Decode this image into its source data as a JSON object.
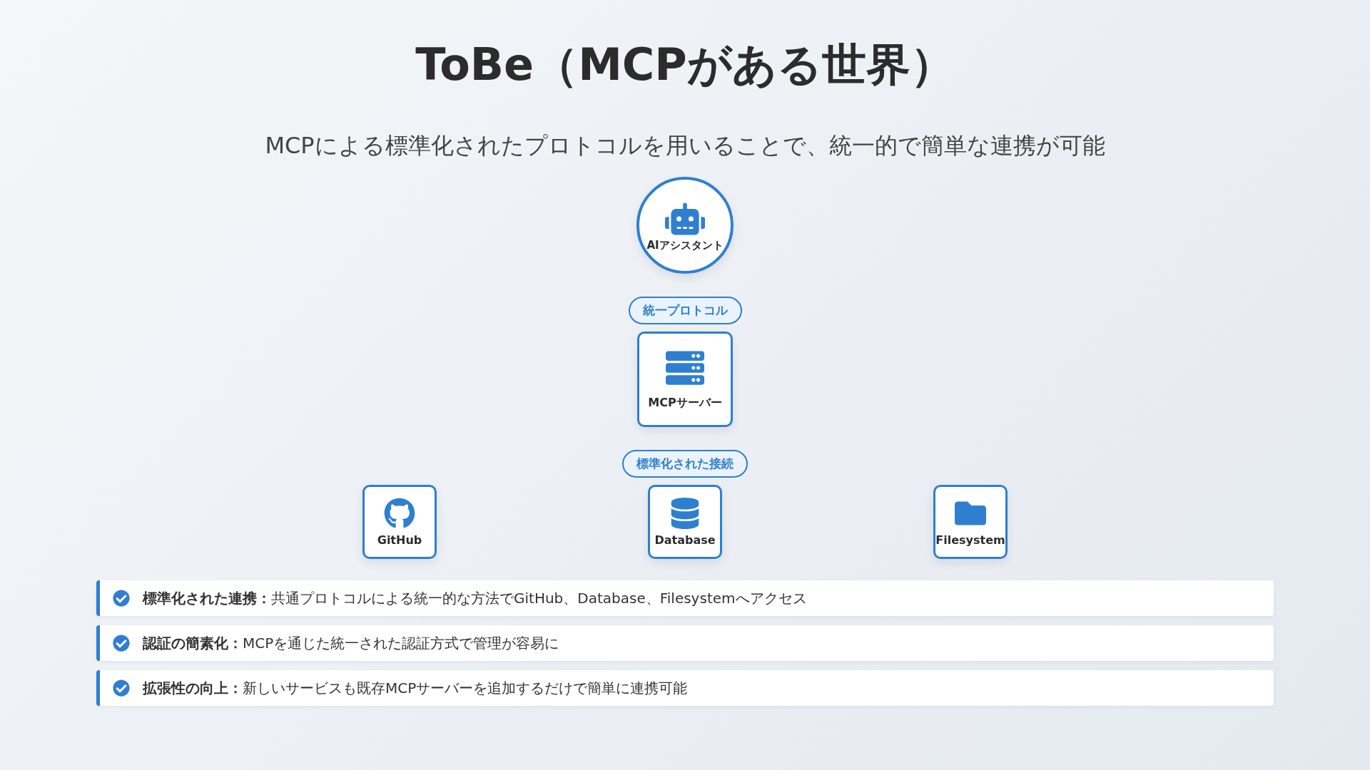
{
  "title": "ToBe（MCPがある世界）",
  "subtitle": "MCPによる標準化されたプロトコルを用いることで、統一的で簡単な連携が可能",
  "assistant": {
    "label": "AIアシスタント"
  },
  "protocol_badge": "統一プロトコル",
  "server": {
    "label": "MCPサーバー"
  },
  "connection_badge": "標準化された接続",
  "services": [
    {
      "label": "GitHub"
    },
    {
      "label": "Database"
    },
    {
      "label": "Filesystem"
    }
  ],
  "benefits": [
    {
      "text": "**標準化された連携：**共通プロトコルによる統一的な方法でGitHub、Database、Filesystemへアクセス"
    },
    {
      "text": "**認証の簡素化：**MCPを通じた統一された認証方式で管理が容易に"
    },
    {
      "text": "**拡張性の向上：**新しいサービスも既存MCPサーバーを追加するだけで簡単に連携可能"
    }
  ]
}
